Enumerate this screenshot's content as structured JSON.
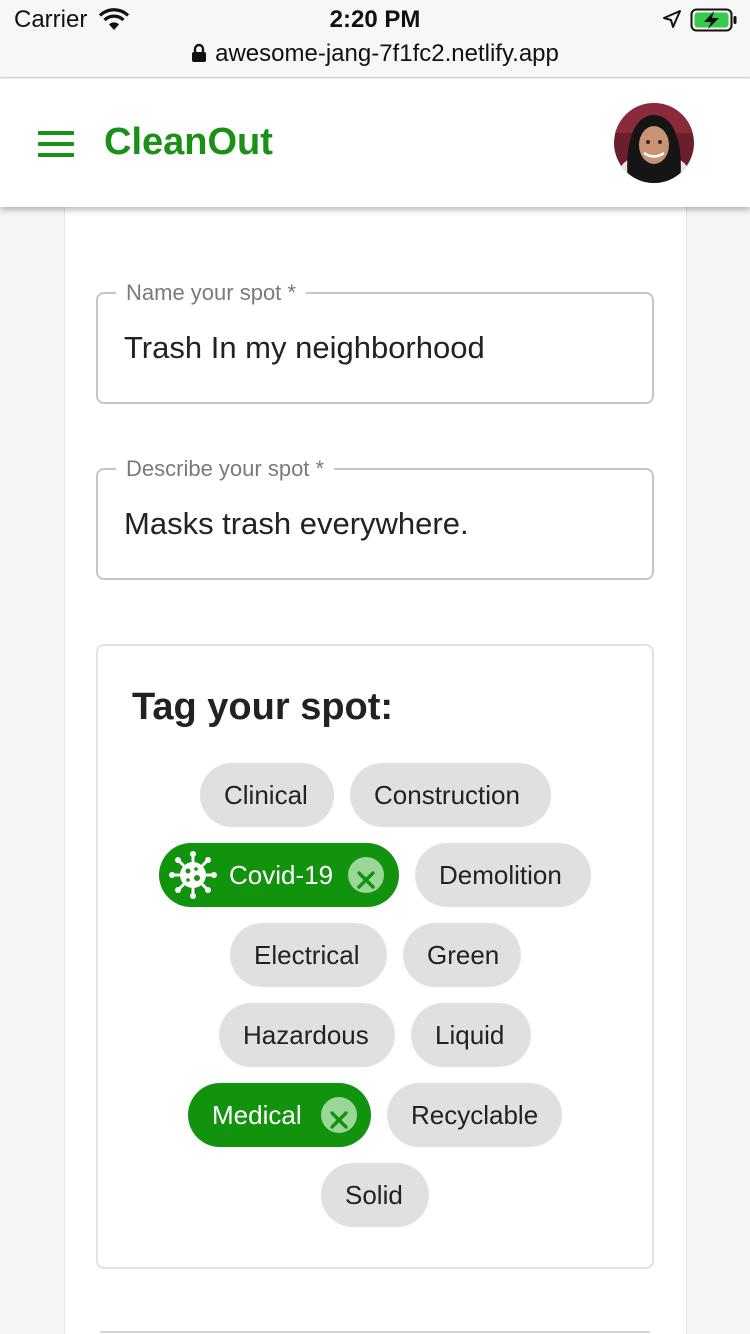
{
  "status_bar": {
    "carrier": "Carrier",
    "time": "2:20 PM",
    "url": "awesome-jang-7f1fc2.netlify.app"
  },
  "app_bar": {
    "title": "CleanOut",
    "brand_color": "#1a9017"
  },
  "form": {
    "name_label": "Name your spot *",
    "name_value": "Trash In my neighborhood",
    "description_label": "Describe your spot *",
    "description_value": "Masks trash everywhere."
  },
  "tags": {
    "title": "Tag your spot:",
    "selected_color": "#12930e",
    "items": [
      {
        "label": "Clinical",
        "selected": false
      },
      {
        "label": "Construction",
        "selected": false
      },
      {
        "label": "Covid-19",
        "selected": true,
        "icon": "virus-icon"
      },
      {
        "label": "Demolition",
        "selected": false
      },
      {
        "label": "Electrical",
        "selected": false
      },
      {
        "label": "Green",
        "selected": false
      },
      {
        "label": "Hazardous",
        "selected": false
      },
      {
        "label": "Liquid",
        "selected": false
      },
      {
        "label": "Medical",
        "selected": true
      },
      {
        "label": "Recyclable",
        "selected": false
      },
      {
        "label": "Solid",
        "selected": false
      }
    ]
  }
}
